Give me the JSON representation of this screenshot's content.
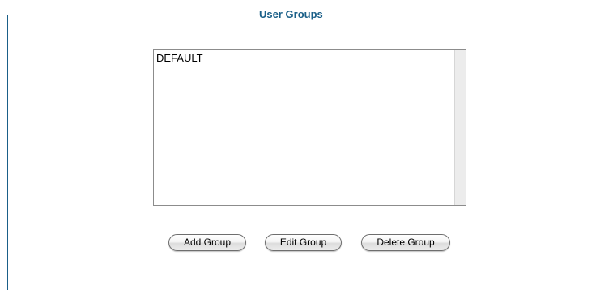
{
  "fieldset": {
    "legend": "User Groups"
  },
  "groups_list": {
    "items": [
      "DEFAULT"
    ]
  },
  "buttons": {
    "add_label": "Add Group",
    "edit_label": "Edit Group",
    "delete_label": "Delete Group"
  },
  "colors": {
    "legend_text": "#1a5f88",
    "frame_border": "#1a5f88"
  }
}
